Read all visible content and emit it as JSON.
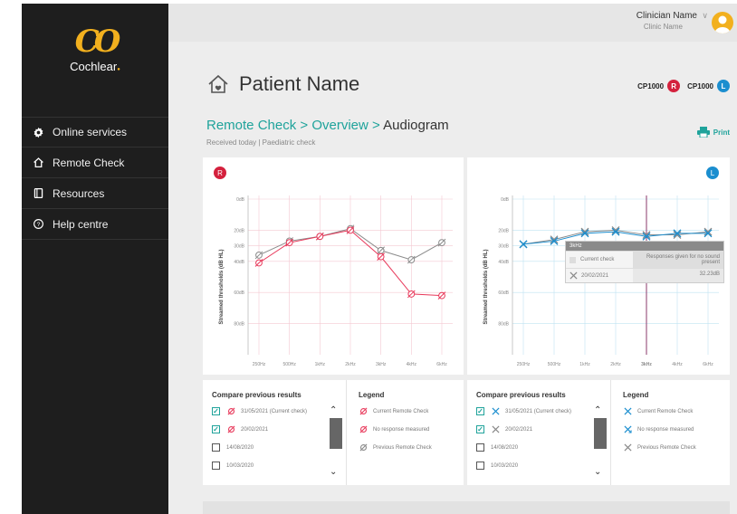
{
  "brand": {
    "logo_text": "Cochlear",
    "logo_mark": "CO"
  },
  "sidebar": {
    "items": [
      {
        "label": "Online services",
        "icon": "gear-icon"
      },
      {
        "label": "Remote Check",
        "icon": "home-icon"
      },
      {
        "label": "Resources",
        "icon": "book-icon"
      },
      {
        "label": "Help centre",
        "icon": "help-icon"
      }
    ]
  },
  "header": {
    "clinician_name": "Clinician Name",
    "clinic_name": "Clinic Name"
  },
  "patient": {
    "name": "Patient Name"
  },
  "devices": [
    {
      "model": "CP1000",
      "side": "R",
      "color": "#d4213d"
    },
    {
      "model": "CP1000",
      "side": "L",
      "color": "#1b8ecf"
    }
  ],
  "breadcrumb": {
    "part1": "Remote Check",
    "sep1": " > ",
    "part2": "Overview",
    "sep2": " > ",
    "current": "Audiogram"
  },
  "received": "Received today | Paediatric check",
  "print_label": "Print",
  "colors": {
    "accent": "#1fa39b",
    "right": "#e8385a",
    "left": "#1b8ecf",
    "previous": "#8a8a8a"
  },
  "chart_data": [
    {
      "type": "line",
      "ear": "R",
      "x": [
        "250Hz",
        "500Hz",
        "1kHz",
        "2kHz",
        "3kHz",
        "4kHz",
        "6kHz"
      ],
      "ylabel": "Streamed thresholds (dB HL)",
      "yticks": [
        "0dB",
        "20dB",
        "30dB",
        "40dB",
        "60dB",
        "80dB"
      ],
      "ylim": [
        0,
        100
      ],
      "series": [
        {
          "name": "Current Remote Check",
          "values": [
            41,
            28,
            24,
            20,
            37,
            61,
            62
          ],
          "color": "#e8385a"
        },
        {
          "name": "Previous Remote Check",
          "values": [
            36,
            27,
            24,
            19,
            33,
            39,
            28
          ],
          "color": "#8a8a8a"
        }
      ]
    },
    {
      "type": "line",
      "ear": "L",
      "x": [
        "250Hz",
        "500Hz",
        "1kHz",
        "2kHz",
        "3kHz",
        "4kHz",
        "6kHz"
      ],
      "ylabel": "Streamed thresholds (dB HL)",
      "yticks": [
        "0dB",
        "20dB",
        "30dB",
        "40dB",
        "60dB",
        "80dB"
      ],
      "ylim": [
        0,
        100
      ],
      "highlight": "3kHz",
      "series": [
        {
          "name": "Current Remote Check",
          "values": [
            29,
            27,
            22,
            21,
            24,
            22,
            22
          ],
          "color": "#1b8ecf"
        },
        {
          "name": "Previous Remote Check",
          "values": [
            29,
            26,
            21,
            20,
            23,
            23,
            21
          ],
          "color": "#8a8a8a"
        }
      ],
      "tooltip": {
        "freq": "3kHz",
        "col1": "Current check",
        "col2": "Responses given for no sound present",
        "row_label": "20/02/2021",
        "row_value": "32.23dB"
      }
    }
  ],
  "compare": {
    "title": "Compare previous results",
    "items": [
      {
        "label": "31/05/2021 (Current check)",
        "checked": true,
        "marker": true
      },
      {
        "label": "20/02/2021",
        "checked": true,
        "marker": true
      },
      {
        "label": "14/08/2020",
        "checked": false,
        "marker": false
      },
      {
        "label": "10/03/2020",
        "checked": false,
        "marker": false
      }
    ]
  },
  "legend": {
    "title": "Legend",
    "items": [
      "Current Remote Check",
      "No response measured",
      "Previous Remote Check"
    ]
  }
}
